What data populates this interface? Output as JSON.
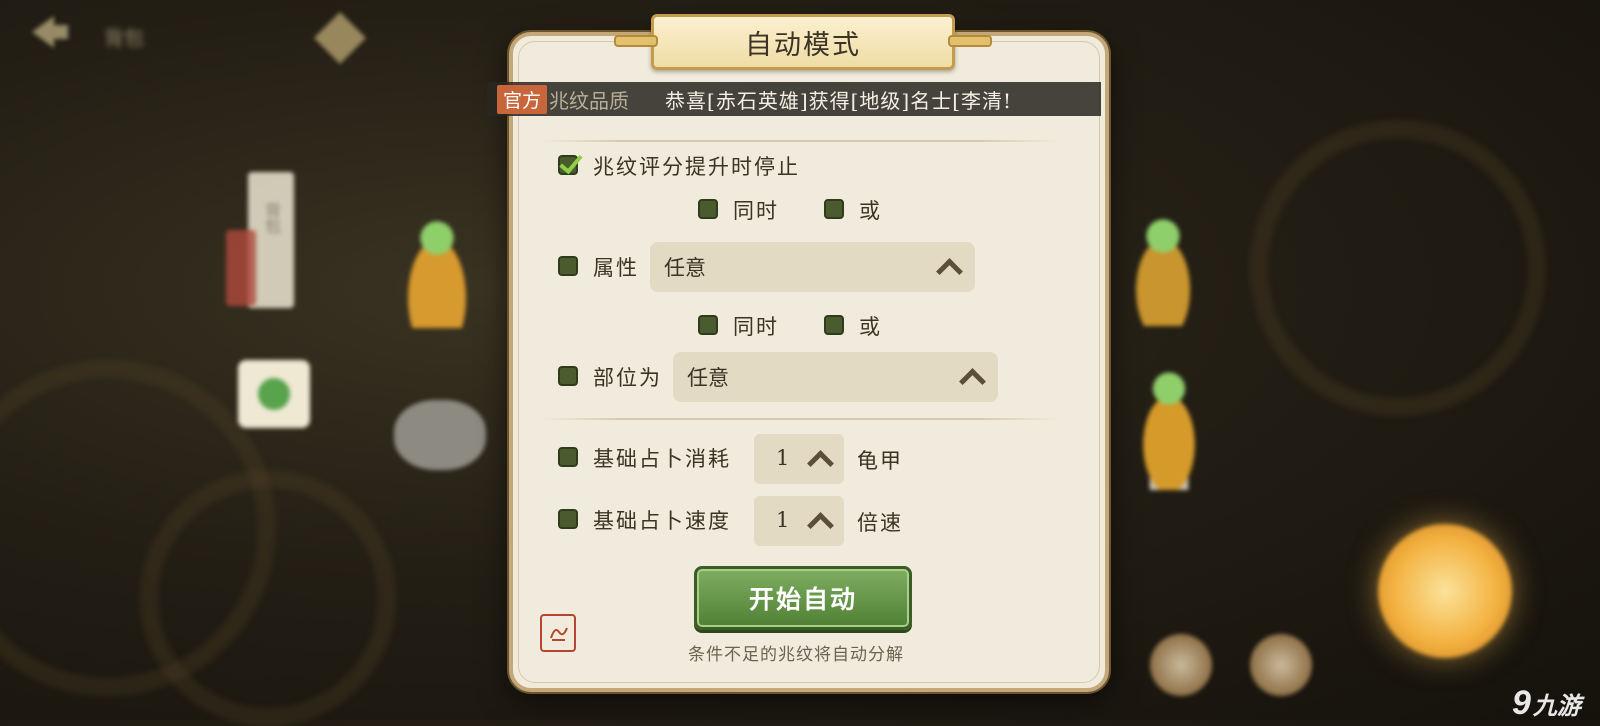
{
  "background": {
    "top_title": "背包",
    "banner_text": "背包"
  },
  "dialog": {
    "title": "自动模式",
    "broadcast": {
      "tag": "官方",
      "previous_label": "兆纹品质",
      "message": "恭喜[赤石英雄]获得[地级]名士[李清!"
    },
    "stop_on_improve": {
      "label": "兆纹评分提升时停止",
      "checked": true
    },
    "logic_row_1": {
      "and_label": "同时",
      "or_label": "或"
    },
    "attribute": {
      "label": "属性",
      "value": "任意"
    },
    "logic_row_2": {
      "and_label": "同时",
      "or_label": "或"
    },
    "position": {
      "label": "部位为",
      "value": "任意"
    },
    "base_cost": {
      "label": "基础占卜消耗",
      "value": "1",
      "unit": "龟甲"
    },
    "base_speed": {
      "label": "基础占卜速度",
      "value": "1",
      "unit": "倍速"
    },
    "start_button": "开始自动",
    "hint": "条件不足的兆纹将自动分解"
  },
  "watermark": {
    "glyph": "9",
    "text": "九游"
  },
  "colors": {
    "checkbox": "#4a5b2e",
    "check_mark": "#8fcf44",
    "start_button": "#5e8f42",
    "panel": "#f0ebdc",
    "tag": "#c9653a"
  }
}
